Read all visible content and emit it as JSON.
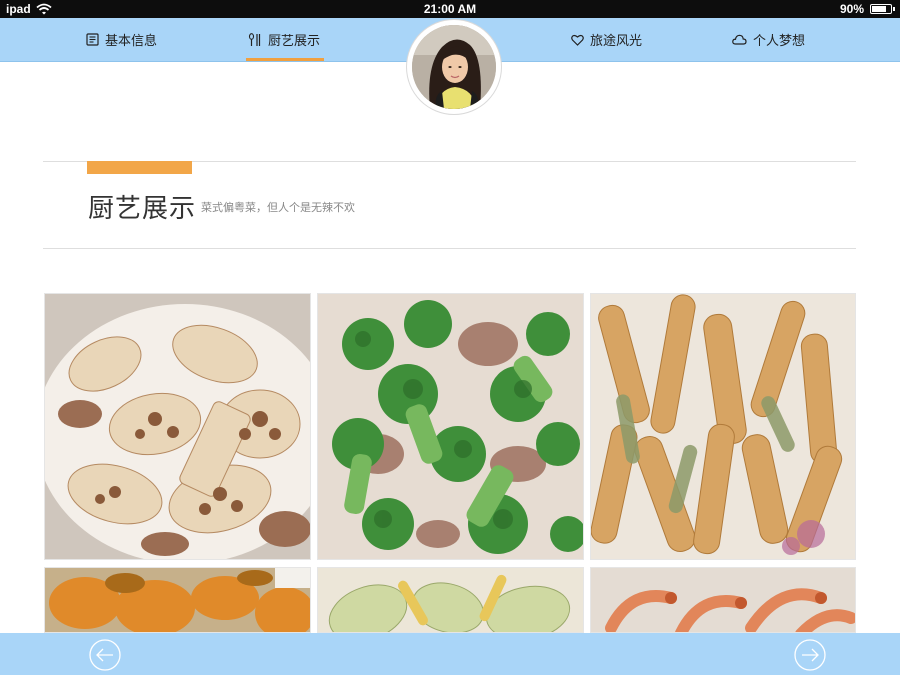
{
  "status_bar": {
    "device": "ipad",
    "time": "21:00 AM",
    "battery": "90%",
    "battery_level": 0.9
  },
  "nav": {
    "items": [
      {
        "label": "基本信息",
        "icon": "document-icon"
      },
      {
        "label": "厨艺展示",
        "icon": "cutlery-icon",
        "active": true
      },
      {
        "label": "旅途风光",
        "icon": "heart-icon"
      },
      {
        "label": "个人梦想",
        "icon": "cloud-icon"
      }
    ]
  },
  "section": {
    "title": "厨艺展示",
    "subtitle": "菜式偏粤菜，但人个是无辣不欢"
  },
  "gallery": {
    "items": [
      {
        "name": "lotus-root-pork-photo"
      },
      {
        "name": "broccoli-pork-photo"
      },
      {
        "name": "fried-strips-photo"
      },
      {
        "name": "pumpkin-dish-photo"
      },
      {
        "name": "squash-stirfry-photo"
      },
      {
        "name": "shrimp-dish-photo"
      }
    ]
  },
  "colors": {
    "nav_background": "#a9d5f8",
    "accent": "#f2a648"
  },
  "footer": {
    "prev_icon": "arrow-left-icon",
    "next_icon": "arrow-right-icon"
  }
}
